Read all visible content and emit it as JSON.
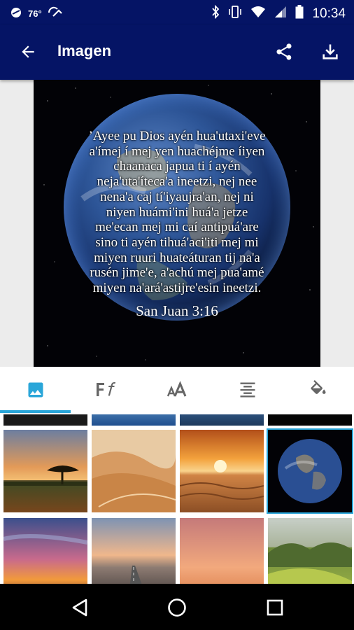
{
  "status_bar": {
    "temperature": "76°",
    "time": "10:34"
  },
  "app_bar": {
    "title": "Imagen",
    "back_icon": "arrow-back-icon",
    "share_icon": "share-icon",
    "download_icon": "download-icon"
  },
  "preview": {
    "verse_lines": [
      "ʼAyee pu Dios ayén hua'utaxi'eve",
      "a'ímej í mej yen huachéjme íiyen",
      "chaanaca japua ti í ayén",
      "neja'uta'íteca'a ineetzi, nej nee",
      "nena'a caj tí'iyaujra'an, nej ni",
      "niyen huámi'ini huá'a jetze",
      "me'ecan mej mi caí antipuá'are",
      "sino ti ayén tihuá'aci'iti mej mi",
      "miyen ruuri huateáturan tij na'a",
      "rusén jime'e, a'achú mej pua'amé",
      "miyen na'ará'astijre'esin ineetzi."
    ],
    "reference": "San Juan 3:16"
  },
  "tabs": [
    {
      "icon": "image-icon",
      "active": true
    },
    {
      "icon": "font-family-icon",
      "active": false
    },
    {
      "icon": "font-size-icon",
      "active": false
    },
    {
      "icon": "text-align-center-icon",
      "active": false
    },
    {
      "icon": "fill-color-icon",
      "active": false
    }
  ],
  "gallery": {
    "thumbnails": [
      {
        "name": "savanna-sunset",
        "selected": false
      },
      {
        "name": "desert-dunes",
        "selected": false
      },
      {
        "name": "desert-sunset",
        "selected": false
      },
      {
        "name": "earth",
        "selected": true
      },
      {
        "name": "sunset-clouds",
        "selected": false
      },
      {
        "name": "road",
        "selected": false
      },
      {
        "name": "pink-sky",
        "selected": false
      },
      {
        "name": "green-hills",
        "selected": false
      }
    ]
  },
  "colors": {
    "app_bar": "#051465",
    "tab_indicator": "#2aa6d9",
    "active_tab_icon": "#2aa6d9",
    "inactive_tab_icon": "#666666",
    "selected_border": "#2aa6d9"
  }
}
